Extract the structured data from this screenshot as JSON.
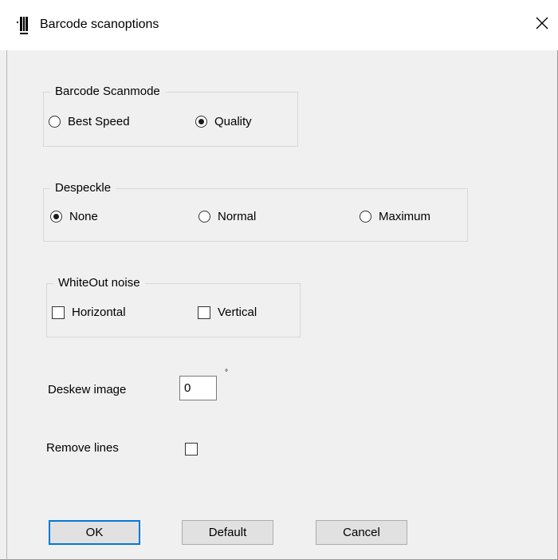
{
  "window": {
    "title": "Barcode scanoptions",
    "icon": "barcode-icon",
    "close_icon": "close-icon"
  },
  "scanmode": {
    "legend": "Barcode Scanmode",
    "options": [
      {
        "label": "Best Speed",
        "checked": false
      },
      {
        "label": "Quality",
        "checked": true
      }
    ]
  },
  "despeckle": {
    "legend": "Despeckle",
    "options": [
      {
        "label": "None",
        "checked": true
      },
      {
        "label": "Normal",
        "checked": false
      },
      {
        "label": "Maximum",
        "checked": false
      }
    ]
  },
  "whiteout": {
    "legend": "WhiteOut noise",
    "options": [
      {
        "label": "Horizontal",
        "checked": false
      },
      {
        "label": "Vertical",
        "checked": false
      }
    ]
  },
  "deskew": {
    "label": "Deskew image",
    "value": "0",
    "unit": "°"
  },
  "remove_lines": {
    "label": "Remove lines",
    "checked": false
  },
  "buttons": {
    "ok": "OK",
    "default": "Default",
    "cancel": "Cancel"
  }
}
